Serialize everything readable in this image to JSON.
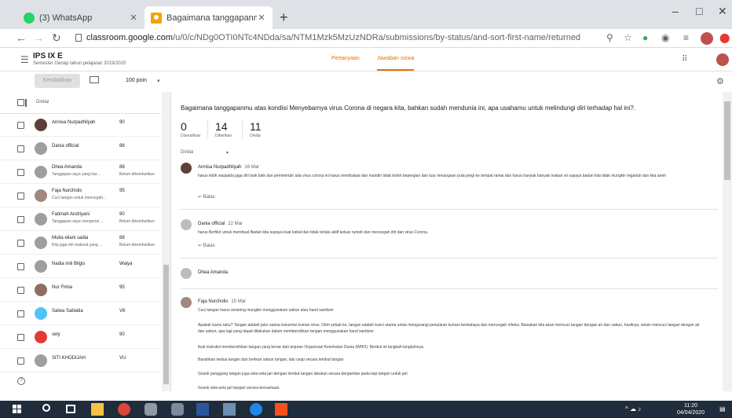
{
  "browser": {
    "tabs": [
      {
        "title": "(3) WhatsApp",
        "icon": "whatsapp-icon"
      },
      {
        "title": "Bagaimana tanggapanmu atas k",
        "icon": "classroom-icon"
      }
    ],
    "new_tab": "+",
    "url_host": "classroom.google.com",
    "url_path": "/u/0/c/NDg0OTI0NTc4NDda/sa/NTM1Mzk5MzUzNDRa/submissions/by-status/and-sort-first-name/returned"
  },
  "app": {
    "class_name": "IPS IX E",
    "class_sub": "Semester Genap tahun pelajaran 2019/2020",
    "tabs": [
      "Pertanyaan",
      "Jawaban siswa"
    ]
  },
  "toolbar": {
    "return_label": "Kembalikan",
    "points": "100 poin"
  },
  "list": {
    "header": "Dinilai",
    "students": [
      {
        "name": "Annisa Nurpadhilyah",
        "sub": "",
        "grade": "90",
        "status": "",
        "color": "#5d4037"
      },
      {
        "name": "Dania official",
        "sub": "",
        "grade": "88",
        "status": "",
        "color": "#9e9e9e"
      },
      {
        "name": "Dhea Amanda",
        "sub": "Tanggapan saya yang har...",
        "grade": "88",
        "status": "Belum dikembalikan",
        "color": "#9e9e9e"
      },
      {
        "name": "Faja Nurcholis",
        "sub": "Cuci tangan untuk mencegah...",
        "grade": "95",
        "status": "",
        "color": "#a1887f"
      },
      {
        "name": "Fatimah Andriyani",
        "sub": "Tanggapan saya mengenai ...",
        "grade": "90",
        "status": "Belum dikembalikan",
        "color": "#9e9e9e"
      },
      {
        "name": "Mutia eliani sadia",
        "sub": "Kita jaga diri maksud yang ...",
        "grade": "88",
        "status": "Belum dikembalikan",
        "color": "#9e9e9e"
      },
      {
        "name": "Nadia miii Bilgis",
        "sub": "",
        "grade": "Waiya",
        "status": "",
        "color": "#9e9e9e"
      },
      {
        "name": "Nur Fimia",
        "sub": "",
        "grade": "95",
        "status": "",
        "color": "#8d6e63"
      },
      {
        "name": "Salwa Sabiatia",
        "sub": "",
        "grade": "V6",
        "status": "",
        "color": "#4fc3f7"
      },
      {
        "name": "sely",
        "sub": "",
        "grade": "90",
        "status": "",
        "color": "#e53935"
      },
      {
        "name": "SITI KHODIJAH",
        "sub": "",
        "grade": "VU",
        "status": "",
        "color": "#9e9e9e"
      }
    ]
  },
  "detail": {
    "question": "Bagaimana tanggapanmu atas kondisi Menyebarnya virus Corona di negara kita, bahkan sudah mendunia ini, apa usahamu untuk melindungi diri terhadap hal ini?.",
    "stats": [
      {
        "num": "0",
        "label": "Diserahkan"
      },
      {
        "num": "14",
        "label": "Diberikan"
      },
      {
        "num": "11",
        "label": "Dinilai"
      }
    ],
    "filter": "Dinilai",
    "answers": [
      {
        "name": "Annisa Nurpadhilyah",
        "date": "16 Mar",
        "text": "harus lebih waspada jaga diri baik baik dan pemerintah ada virus corona ini harus membatasi dan mandiri tidak boleh bepergian dan luar mmangsan pula pergi ke tempat ramai dan harus banyak banyak makan vit supaya badan kita tidak mungkin tegarlah dan kita aneh",
        "reply": "Balas"
      },
      {
        "name": "Dania official",
        "date": "22 Mar",
        "text": "harus Berfikir untuk membuat Badan kita supaya kuat kebal dan tidak terlalu aktif keluar rumah dan mencegah diri dan virus Corona.",
        "reply": "Balas"
      },
      {
        "name": "Dhea Amanda",
        "date": "",
        "text": "",
        "reply": ""
      },
      {
        "name": "Faja Nurcholis",
        "date": "15 Mar",
        "text": "Cuci tangan harus sesering mungkin menggunakan sabun atau hand sanitizer",
        "reply": ""
      }
    ],
    "paragraphs": [
      "Apakah kamu tahu? Tangan adalah jalur utama transmisi kuman virus. Oleh sebab itu, tangan adalah kunci utama untuk mengurangi penularan kuman berbahaya dan mencegah infeksi. Biasakan kita akan mencuci tangan dengan air dan sabun, hasilnya, selain mencuci tangan dengan air dan sabun, apa lagi yang dapat dilakukan dalam membersihkan tangan menggunakan hand sanitizer.",
      "Ikuti instruksi membersihkan tangan yang benar dari anjuran Organisasi Kesehatan Dunia (WHO). Berikut ini langkah-langkahnya.",
      "Basahkan kedua tangan dan berikan sabun tangan, lalu usap secara lembut tangan",
      "Gosok punggung tangan juga sela-sela jari dengan lembut tangan lakukan secara bergantian pada tiap tangan untuk jari",
      "Gosok sela-sela jari tangan secara bersamaan."
    ]
  },
  "taskbar": {
    "time": "11:20",
    "date": "04/04/2020"
  }
}
